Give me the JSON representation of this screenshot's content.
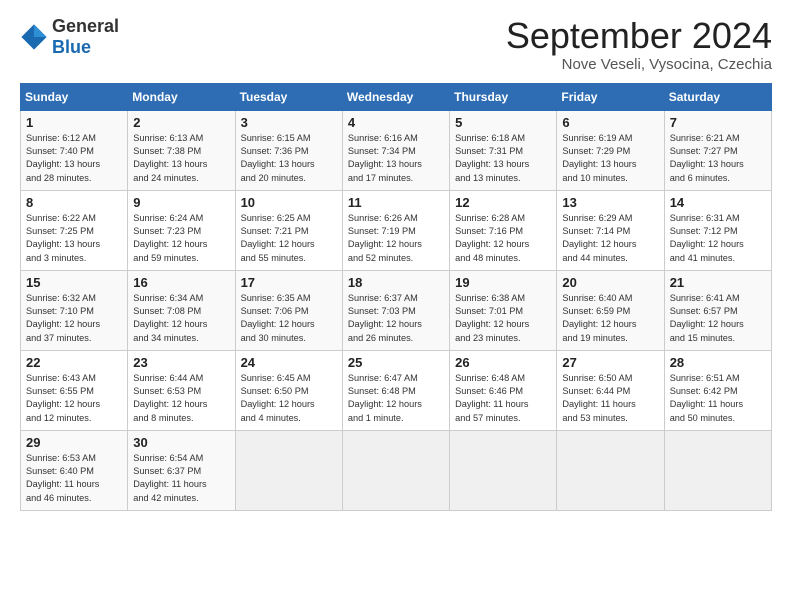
{
  "logo": {
    "general": "General",
    "blue": "Blue"
  },
  "title": "September 2024",
  "subtitle": "Nove Veseli, Vysocina, Czechia",
  "headers": [
    "Sunday",
    "Monday",
    "Tuesday",
    "Wednesday",
    "Thursday",
    "Friday",
    "Saturday"
  ],
  "weeks": [
    [
      {
        "day": "1",
        "info": "Sunrise: 6:12 AM\nSunset: 7:40 PM\nDaylight: 13 hours\nand 28 minutes."
      },
      {
        "day": "2",
        "info": "Sunrise: 6:13 AM\nSunset: 7:38 PM\nDaylight: 13 hours\nand 24 minutes."
      },
      {
        "day": "3",
        "info": "Sunrise: 6:15 AM\nSunset: 7:36 PM\nDaylight: 13 hours\nand 20 minutes."
      },
      {
        "day": "4",
        "info": "Sunrise: 6:16 AM\nSunset: 7:34 PM\nDaylight: 13 hours\nand 17 minutes."
      },
      {
        "day": "5",
        "info": "Sunrise: 6:18 AM\nSunset: 7:31 PM\nDaylight: 13 hours\nand 13 minutes."
      },
      {
        "day": "6",
        "info": "Sunrise: 6:19 AM\nSunset: 7:29 PM\nDaylight: 13 hours\nand 10 minutes."
      },
      {
        "day": "7",
        "info": "Sunrise: 6:21 AM\nSunset: 7:27 PM\nDaylight: 13 hours\nand 6 minutes."
      }
    ],
    [
      {
        "day": "8",
        "info": "Sunrise: 6:22 AM\nSunset: 7:25 PM\nDaylight: 13 hours\nand 3 minutes."
      },
      {
        "day": "9",
        "info": "Sunrise: 6:24 AM\nSunset: 7:23 PM\nDaylight: 12 hours\nand 59 minutes."
      },
      {
        "day": "10",
        "info": "Sunrise: 6:25 AM\nSunset: 7:21 PM\nDaylight: 12 hours\nand 55 minutes."
      },
      {
        "day": "11",
        "info": "Sunrise: 6:26 AM\nSunset: 7:19 PM\nDaylight: 12 hours\nand 52 minutes."
      },
      {
        "day": "12",
        "info": "Sunrise: 6:28 AM\nSunset: 7:16 PM\nDaylight: 12 hours\nand 48 minutes."
      },
      {
        "day": "13",
        "info": "Sunrise: 6:29 AM\nSunset: 7:14 PM\nDaylight: 12 hours\nand 44 minutes."
      },
      {
        "day": "14",
        "info": "Sunrise: 6:31 AM\nSunset: 7:12 PM\nDaylight: 12 hours\nand 41 minutes."
      }
    ],
    [
      {
        "day": "15",
        "info": "Sunrise: 6:32 AM\nSunset: 7:10 PM\nDaylight: 12 hours\nand 37 minutes."
      },
      {
        "day": "16",
        "info": "Sunrise: 6:34 AM\nSunset: 7:08 PM\nDaylight: 12 hours\nand 34 minutes."
      },
      {
        "day": "17",
        "info": "Sunrise: 6:35 AM\nSunset: 7:06 PM\nDaylight: 12 hours\nand 30 minutes."
      },
      {
        "day": "18",
        "info": "Sunrise: 6:37 AM\nSunset: 7:03 PM\nDaylight: 12 hours\nand 26 minutes."
      },
      {
        "day": "19",
        "info": "Sunrise: 6:38 AM\nSunset: 7:01 PM\nDaylight: 12 hours\nand 23 minutes."
      },
      {
        "day": "20",
        "info": "Sunrise: 6:40 AM\nSunset: 6:59 PM\nDaylight: 12 hours\nand 19 minutes."
      },
      {
        "day": "21",
        "info": "Sunrise: 6:41 AM\nSunset: 6:57 PM\nDaylight: 12 hours\nand 15 minutes."
      }
    ],
    [
      {
        "day": "22",
        "info": "Sunrise: 6:43 AM\nSunset: 6:55 PM\nDaylight: 12 hours\nand 12 minutes."
      },
      {
        "day": "23",
        "info": "Sunrise: 6:44 AM\nSunset: 6:53 PM\nDaylight: 12 hours\nand 8 minutes."
      },
      {
        "day": "24",
        "info": "Sunrise: 6:45 AM\nSunset: 6:50 PM\nDaylight: 12 hours\nand 4 minutes."
      },
      {
        "day": "25",
        "info": "Sunrise: 6:47 AM\nSunset: 6:48 PM\nDaylight: 12 hours\nand 1 minute."
      },
      {
        "day": "26",
        "info": "Sunrise: 6:48 AM\nSunset: 6:46 PM\nDaylight: 11 hours\nand 57 minutes."
      },
      {
        "day": "27",
        "info": "Sunrise: 6:50 AM\nSunset: 6:44 PM\nDaylight: 11 hours\nand 53 minutes."
      },
      {
        "day": "28",
        "info": "Sunrise: 6:51 AM\nSunset: 6:42 PM\nDaylight: 11 hours\nand 50 minutes."
      }
    ],
    [
      {
        "day": "29",
        "info": "Sunrise: 6:53 AM\nSunset: 6:40 PM\nDaylight: 11 hours\nand 46 minutes."
      },
      {
        "day": "30",
        "info": "Sunrise: 6:54 AM\nSunset: 6:37 PM\nDaylight: 11 hours\nand 42 minutes."
      },
      {
        "day": "",
        "info": ""
      },
      {
        "day": "",
        "info": ""
      },
      {
        "day": "",
        "info": ""
      },
      {
        "day": "",
        "info": ""
      },
      {
        "day": "",
        "info": ""
      }
    ]
  ]
}
